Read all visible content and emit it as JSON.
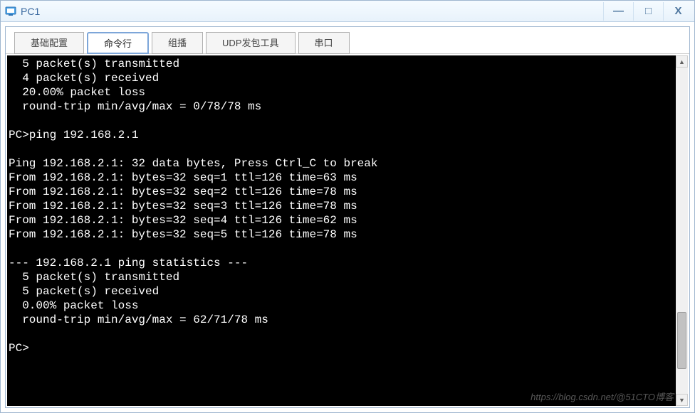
{
  "window": {
    "title": "PC1"
  },
  "tabs": [
    {
      "id": "basic",
      "label": "基础配置"
    },
    {
      "id": "cli",
      "label": "命令行"
    },
    {
      "id": "mcast",
      "label": "组播"
    },
    {
      "id": "udp",
      "label": "UDP发包工具"
    },
    {
      "id": "serial",
      "label": "串口"
    }
  ],
  "active_tab": "cli",
  "console_lines": [
    "  5 packet(s) transmitted",
    "  4 packet(s) received",
    "  20.00% packet loss",
    "  round-trip min/avg/max = 0/78/78 ms",
    "",
    "PC>ping 192.168.2.1",
    "",
    "Ping 192.168.2.1: 32 data bytes, Press Ctrl_C to break",
    "From 192.168.2.1: bytes=32 seq=1 ttl=126 time=63 ms",
    "From 192.168.2.1: bytes=32 seq=2 ttl=126 time=78 ms",
    "From 192.168.2.1: bytes=32 seq=3 ttl=126 time=78 ms",
    "From 192.168.2.1: bytes=32 seq=4 ttl=126 time=62 ms",
    "From 192.168.2.1: bytes=32 seq=5 ttl=126 time=78 ms",
    "",
    "--- 192.168.2.1 ping statistics ---",
    "  5 packet(s) transmitted",
    "  5 packet(s) received",
    "  0.00% packet loss",
    "  round-trip min/avg/max = 62/71/78 ms",
    "",
    "PC>",
    ""
  ],
  "watermark": "https://blog.csdn.net/@51CTO博客"
}
